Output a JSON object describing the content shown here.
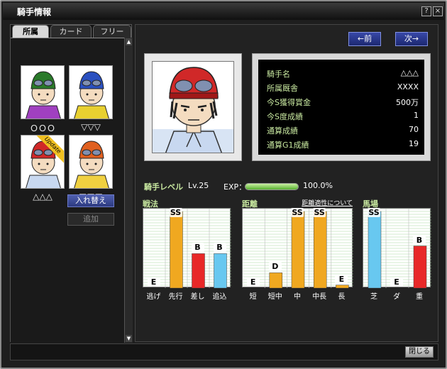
{
  "window": {
    "title": "騎手情報",
    "help_label": "?",
    "close_label": "×"
  },
  "tabs": [
    {
      "label": "所属",
      "active": true
    },
    {
      "label": "カード",
      "active": false
    },
    {
      "label": "フリー",
      "active": false
    }
  ],
  "jockeys": [
    {
      "name": "ＯＯＯ",
      "helmet": "#2a7a2a",
      "silks": "#a040c0",
      "update": false
    },
    {
      "name": "▽▽▽",
      "helmet": "#2a50c0",
      "silks": "#e8d030",
      "update": false
    },
    {
      "name": "△△△",
      "helmet": "#d02828",
      "silks": "#c8d8f0",
      "update": true,
      "update_label": "Update"
    },
    {
      "name": "□□□",
      "helmet": "#e06020",
      "silks": "#f0d040",
      "update": false
    }
  ],
  "buttons": {
    "swap": "入れ替え",
    "add": "追加",
    "prev": "←前",
    "next": "次→",
    "close": "閉じる"
  },
  "profile": {
    "rows": [
      {
        "label": "騎手名",
        "value": "△△△"
      },
      {
        "label": "所属厩舎",
        "value": "XXXX"
      },
      {
        "label": "今S獲得賞金",
        "value": "500万"
      },
      {
        "label": "今S度成績",
        "value": "1"
      },
      {
        "label": "通算成績",
        "value": "70"
      },
      {
        "label": "通算G1成績",
        "value": "19"
      }
    ],
    "portrait_helmet": "#d02828"
  },
  "level": {
    "label": "騎手レベル",
    "value": "Lv.25",
    "exp_label": "EXP：",
    "exp_percent": "100.0%",
    "exp_fraction": 1.0
  },
  "stats": [
    {
      "title": "戦法",
      "note": "",
      "bars": [
        {
          "label": "逃げ",
          "grade": "E",
          "level": 0.0,
          "color": "#e8a020"
        },
        {
          "label": "先行",
          "grade": "SS",
          "level": 1.0,
          "color": "#f0a820"
        },
        {
          "label": "差し",
          "grade": "B",
          "level": 0.45,
          "color": "#e82828"
        },
        {
          "label": "追込",
          "grade": "B",
          "level": 0.45,
          "color": "#68c8f0"
        }
      ]
    },
    {
      "title": "距離",
      "note": "距離適性について",
      "bars": [
        {
          "label": "短",
          "grade": "E",
          "level": 0.0,
          "color": "#f0a820"
        },
        {
          "label": "短中",
          "grade": "D",
          "level": 0.2,
          "color": "#f0a820"
        },
        {
          "label": "中",
          "grade": "SS",
          "level": 1.0,
          "color": "#f0a820"
        },
        {
          "label": "中長",
          "grade": "SS",
          "level": 1.0,
          "color": "#f0a820"
        },
        {
          "label": "長",
          "grade": "E",
          "level": 0.04,
          "color": "#f0a820"
        }
      ]
    },
    {
      "title": "馬場",
      "note": "",
      "bars": [
        {
          "label": "芝",
          "grade": "SS",
          "level": 1.0,
          "color": "#68c8f0"
        },
        {
          "label": "ダ",
          "grade": "E",
          "level": 0.0,
          "color": "#68c8f0"
        },
        {
          "label": "重",
          "grade": "B",
          "level": 0.55,
          "color": "#e82828"
        }
      ]
    }
  ]
}
